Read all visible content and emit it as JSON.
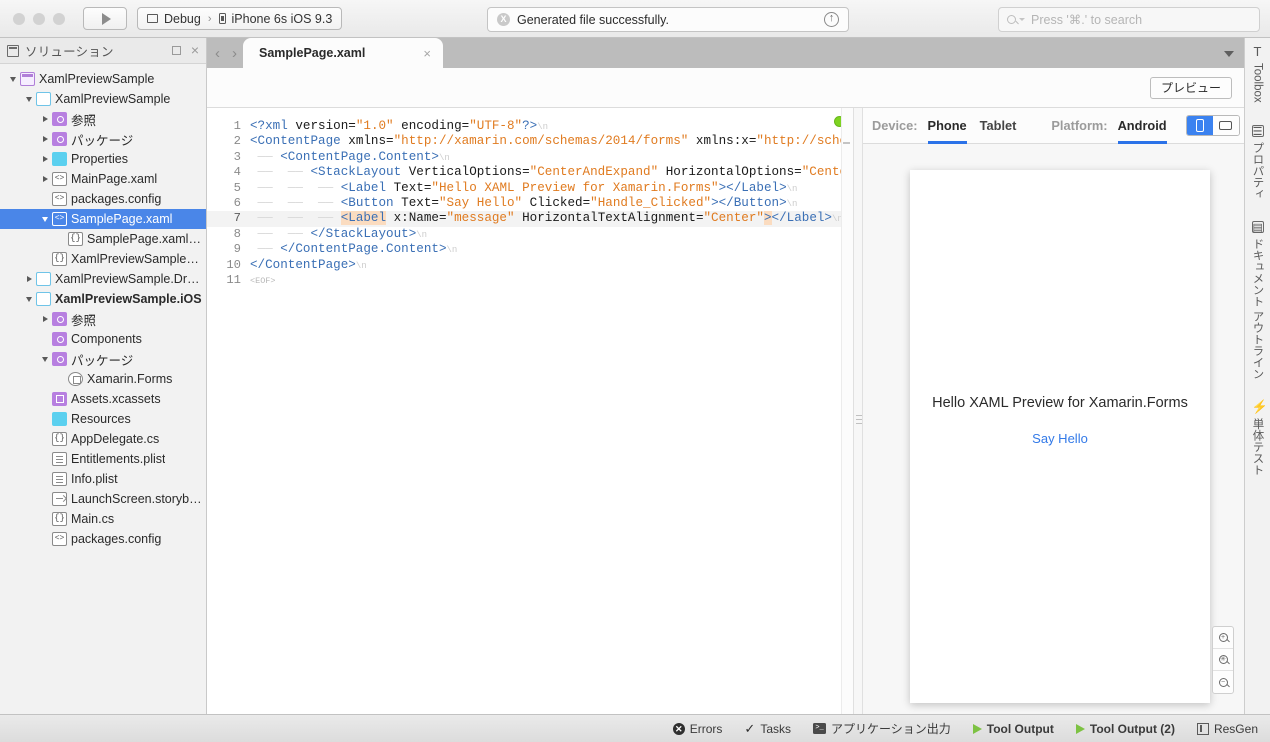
{
  "toolbar": {
    "run_button": "run-button",
    "config_label": "Debug",
    "config_separator": "›",
    "device_label": "iPhone 6s iOS 9.3",
    "status_text": "Generated file successfully.",
    "status_badge": "X",
    "search_placeholder": "Press '⌘.' to search"
  },
  "solution_pad": {
    "title": "ソリューション",
    "tree": [
      {
        "label": "XamlPreviewSample",
        "indent": 0,
        "twisty": "down",
        "icon": "solution-icon",
        "bold": false,
        "selected": false
      },
      {
        "label": "XamlPreviewSample",
        "indent": 1,
        "twisty": "down",
        "icon": "project-icon",
        "bold": false,
        "selected": false
      },
      {
        "label": "参照",
        "indent": 2,
        "twisty": "right",
        "icon": "reference-folder-icon",
        "bold": false,
        "selected": false
      },
      {
        "label": "パッケージ",
        "indent": 2,
        "twisty": "right",
        "icon": "package-folder-icon",
        "bold": false,
        "selected": false
      },
      {
        "label": "Properties",
        "indent": 2,
        "twisty": "right",
        "icon": "folder-icon",
        "bold": false,
        "selected": false
      },
      {
        "label": "MainPage.xaml",
        "indent": 2,
        "twisty": "right",
        "icon": "xaml-file-icon",
        "bold": false,
        "selected": false
      },
      {
        "label": "packages.config",
        "indent": 2,
        "twisty": "none",
        "icon": "xaml-file-icon",
        "bold": false,
        "selected": false
      },
      {
        "label": "SamplePage.xaml",
        "indent": 2,
        "twisty": "down",
        "icon": "xaml-file-icon",
        "bold": false,
        "selected": true
      },
      {
        "label": "SamplePage.xaml.cs",
        "indent": 3,
        "twisty": "none",
        "icon": "cs-file-icon",
        "bold": false,
        "selected": false
      },
      {
        "label": "XamlPreviewSample.cs",
        "indent": 2,
        "twisty": "none",
        "icon": "cs-file-icon",
        "bold": false,
        "selected": false
      },
      {
        "label": "XamlPreviewSample.Droid",
        "indent": 1,
        "twisty": "right",
        "icon": "project-icon",
        "bold": false,
        "selected": false
      },
      {
        "label": "XamlPreviewSample.iOS",
        "indent": 1,
        "twisty": "down",
        "icon": "project-icon",
        "bold": true,
        "selected": false
      },
      {
        "label": "参照",
        "indent": 2,
        "twisty": "right",
        "icon": "reference-folder-icon",
        "bold": false,
        "selected": false
      },
      {
        "label": "Components",
        "indent": 2,
        "twisty": "none",
        "icon": "package-folder-icon",
        "bold": false,
        "selected": false
      },
      {
        "label": "パッケージ",
        "indent": 2,
        "twisty": "down",
        "icon": "package-folder-icon",
        "bold": false,
        "selected": false
      },
      {
        "label": "Xamarin.Forms",
        "indent": 3,
        "twisty": "none",
        "icon": "nuget-package-icon",
        "bold": false,
        "selected": false
      },
      {
        "label": "Assets.xcassets",
        "indent": 2,
        "twisty": "none",
        "icon": "assets-icon",
        "bold": false,
        "selected": false
      },
      {
        "label": "Resources",
        "indent": 2,
        "twisty": "none",
        "icon": "folder-icon",
        "bold": false,
        "selected": false
      },
      {
        "label": "AppDelegate.cs",
        "indent": 2,
        "twisty": "none",
        "icon": "cs-file-icon",
        "bold": false,
        "selected": false
      },
      {
        "label": "Entitlements.plist",
        "indent": 2,
        "twisty": "none",
        "icon": "plist-file-icon",
        "bold": false,
        "selected": false
      },
      {
        "label": "Info.plist",
        "indent": 2,
        "twisty": "none",
        "icon": "plist-file-icon",
        "bold": false,
        "selected": false
      },
      {
        "label": "LaunchScreen.storyboard",
        "indent": 2,
        "twisty": "none",
        "icon": "storyboard-file-icon",
        "bold": false,
        "selected": false
      },
      {
        "label": "Main.cs",
        "indent": 2,
        "twisty": "none",
        "icon": "cs-file-icon",
        "bold": false,
        "selected": false
      },
      {
        "label": "packages.config",
        "indent": 2,
        "twisty": "none",
        "icon": "xaml-file-icon",
        "bold": false,
        "selected": false
      }
    ]
  },
  "editor": {
    "tab_title": "SamplePage.xaml",
    "tab_close": "×",
    "nav_back": "‹",
    "nav_forward": "›",
    "preview_button": "プレビュー",
    "current_line": 7,
    "eof_marker": "<EOF>",
    "lines": [
      {
        "n": 1,
        "tokens": [
          {
            "t": "<?xml ",
            "c": "pi"
          },
          {
            "t": "version=",
            "c": "attr"
          },
          {
            "t": "\"1.0\"",
            "c": "str"
          },
          {
            "t": " encoding=",
            "c": "attr"
          },
          {
            "t": "\"UTF-8\"",
            "c": "str"
          },
          {
            "t": "?>",
            "c": "pi"
          },
          {
            "t": "\\n",
            "c": "eol"
          }
        ]
      },
      {
        "n": 2,
        "tokens": [
          {
            "t": "<ContentPage",
            "c": "tag"
          },
          {
            "t": " xmlns=",
            "c": "attr"
          },
          {
            "t": "\"http://xamarin.com/schemas/2014/forms\"",
            "c": "str"
          },
          {
            "t": " xmlns:x=",
            "c": "attr"
          },
          {
            "t": "\"http://sche",
            "c": "str"
          }
        ]
      },
      {
        "n": 3,
        "tokens": [
          {
            "t": "    ",
            "c": "guide"
          },
          {
            "t": "<ContentPage.Content>",
            "c": "tag"
          },
          {
            "t": "\\n",
            "c": "eol"
          }
        ]
      },
      {
        "n": 4,
        "tokens": [
          {
            "t": "        ",
            "c": "guide"
          },
          {
            "t": "<StackLayout",
            "c": "tag"
          },
          {
            "t": " VerticalOptions=",
            "c": "attr"
          },
          {
            "t": "\"CenterAndExpand\"",
            "c": "str"
          },
          {
            "t": " HorizontalOptions=",
            "c": "attr"
          },
          {
            "t": "\"Cente",
            "c": "str"
          }
        ]
      },
      {
        "n": 5,
        "tokens": [
          {
            "t": "            ",
            "c": "guide"
          },
          {
            "t": "<Label",
            "c": "tag"
          },
          {
            "t": " Text=",
            "c": "attr"
          },
          {
            "t": "\"Hello XAML Preview for Xamarin.Forms\"",
            "c": "str"
          },
          {
            "t": "></Label>",
            "c": "tag"
          },
          {
            "t": "\\n",
            "c": "eol"
          }
        ]
      },
      {
        "n": 6,
        "tokens": [
          {
            "t": "            ",
            "c": "guide"
          },
          {
            "t": "<Button",
            "c": "tag"
          },
          {
            "t": " Text=",
            "c": "attr"
          },
          {
            "t": "\"Say Hello\"",
            "c": "str"
          },
          {
            "t": " Clicked=",
            "c": "attr"
          },
          {
            "t": "\"Handle_Clicked\"",
            "c": "str"
          },
          {
            "t": "></Button>",
            "c": "tag"
          },
          {
            "t": "\\n",
            "c": "eol"
          }
        ]
      },
      {
        "n": 7,
        "tokens": [
          {
            "t": "            ",
            "c": "guide"
          },
          {
            "t": "<Label",
            "c": "tag-hl"
          },
          {
            "t": " x:Name=",
            "c": "attr"
          },
          {
            "t": "\"message\"",
            "c": "str"
          },
          {
            "t": " HorizontalTextAlignment=",
            "c": "attr"
          },
          {
            "t": "\"Center\"",
            "c": "str"
          },
          {
            "t": ">",
            "c": "tag-hl"
          },
          {
            "t": "</Label>",
            "c": "tag"
          },
          {
            "t": "\\n",
            "c": "eol"
          }
        ]
      },
      {
        "n": 8,
        "tokens": [
          {
            "t": "        ",
            "c": "guide"
          },
          {
            "t": "</StackLayout>",
            "c": "tag"
          },
          {
            "t": "\\n",
            "c": "eol"
          }
        ]
      },
      {
        "n": 9,
        "tokens": [
          {
            "t": "    ",
            "c": "guide"
          },
          {
            "t": "</ContentPage.Content>",
            "c": "tag"
          },
          {
            "t": "\\n",
            "c": "eol"
          }
        ]
      },
      {
        "n": 10,
        "tokens": [
          {
            "t": "</ContentPage>",
            "c": "tag"
          },
          {
            "t": "\\n",
            "c": "eol"
          }
        ]
      },
      {
        "n": 11,
        "tokens": [
          {
            "t": "<EOF>",
            "c": "eof"
          }
        ]
      }
    ]
  },
  "preview": {
    "device_label": "Device:",
    "device_options": [
      "Phone",
      "Tablet"
    ],
    "device_selected": "Phone",
    "platform_label": "Platform:",
    "platform_selected": "Android",
    "orientation_selected": "portrait",
    "rendered": {
      "label_text": "Hello XAML Preview for Xamarin.Forms",
      "button_text": "Say Hello",
      "message_text": ""
    },
    "zoom_controls": [
      "zoom-in-icon",
      "zoom-reset-icon",
      "zoom-out-icon"
    ]
  },
  "right_rail": [
    {
      "label": "Toolbox",
      "icon": "toolbox-icon"
    },
    {
      "label": "プロパティ",
      "icon": "properties-icon"
    },
    {
      "label": "ドキュメント アウトライン",
      "icon": "document-outline-icon"
    },
    {
      "label": "単体テスト",
      "icon": "unit-test-icon"
    }
  ],
  "statusbar": {
    "items": [
      {
        "label": "Errors",
        "icon": "error-icon",
        "bold": false
      },
      {
        "label": "Tasks",
        "icon": "check-icon",
        "bold": false
      },
      {
        "label": "アプリケーション出力",
        "icon": "terminal-icon",
        "bold": false
      },
      {
        "label": "Tool Output",
        "icon": "play-icon",
        "bold": true
      },
      {
        "label": "Tool Output (2)",
        "icon": "play-icon",
        "bold": true
      },
      {
        "label": "ResGen",
        "icon": "resgen-icon",
        "bold": false
      }
    ]
  },
  "colors": {
    "accent_blue": "#2b72e8",
    "selection_blue": "#4a86e8",
    "success_green": "#7ed321",
    "string_orange": "#e07b20",
    "tag_blue": "#3a6fb5"
  }
}
